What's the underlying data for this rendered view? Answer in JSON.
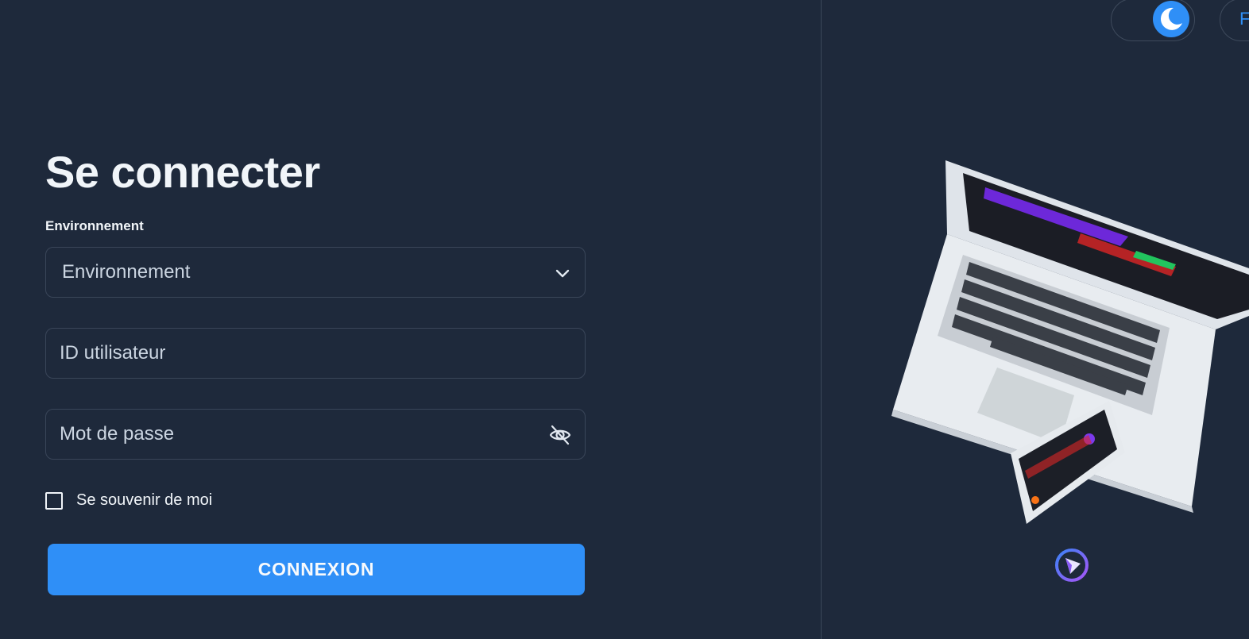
{
  "login": {
    "title": "Se connecter",
    "environment_label": "Environnement",
    "environment_select_value": "Environnement",
    "user_id_placeholder": "ID utilisateur",
    "password_placeholder": "Mot de passe",
    "remember_label": "Se souvenir de moi",
    "submit_label": "CONNEXION"
  },
  "header": {
    "theme_toggle_state": "dark",
    "language_label_partial": "F"
  },
  "icons": {
    "select_arrow": "chevron-down-icon",
    "password_visibility": "eye-off-icon",
    "theme": "moon-icon",
    "brand": "brand-logo-icon"
  },
  "colors": {
    "background": "#1e293b",
    "accent": "#2f8ff7",
    "text": "#f1f5f9",
    "muted_text": "#cbd5e1",
    "border": "#3a4659"
  }
}
